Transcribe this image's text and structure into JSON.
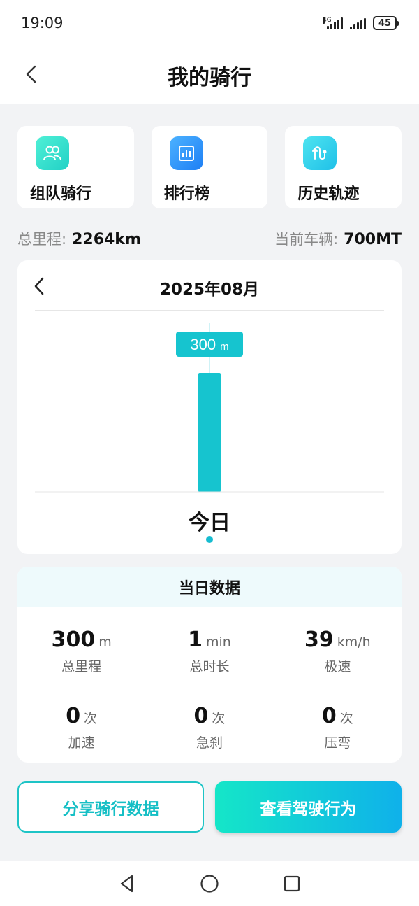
{
  "status_bar": {
    "time": "19:09",
    "network": "4G",
    "battery": "45"
  },
  "header": {
    "title": "我的骑行"
  },
  "quick_actions": [
    {
      "label": "组队骑行",
      "icon": "team-icon",
      "color": "#2ad4c7"
    },
    {
      "label": "排行榜",
      "icon": "ranking-icon",
      "color": "#2a8ff7"
    },
    {
      "label": "历史轨迹",
      "icon": "route-icon",
      "color": "#22c8ea"
    }
  ],
  "summary": {
    "total_distance_label": "总里程:",
    "total_distance_value": "2264km",
    "vehicle_label": "当前车辆:",
    "vehicle_value": "700MT"
  },
  "chart": {
    "month": "2025年08月",
    "tooltip_value": "300",
    "tooltip_unit": "m"
  },
  "chart_data": {
    "type": "bar",
    "categories": [
      "今日"
    ],
    "values": [
      300
    ],
    "unit": "m",
    "title": "2025年08月",
    "xlabel": "",
    "ylabel": "",
    "color": "#16c4cf"
  },
  "daily": {
    "title": "当日数据",
    "stats": [
      {
        "value": "300",
        "unit": "m",
        "label": "总里程"
      },
      {
        "value": "1",
        "unit": "min",
        "label": "总时长"
      },
      {
        "value": "39",
        "unit": "km/h",
        "label": "极速"
      },
      {
        "value": "0",
        "unit": "次",
        "label": "加速"
      },
      {
        "value": "0",
        "unit": "次",
        "label": "急刹"
      },
      {
        "value": "0",
        "unit": "次",
        "label": "压弯"
      }
    ]
  },
  "buttons": {
    "share": "分享骑行数据",
    "behavior": "查看驾驶行为"
  },
  "colors": {
    "accent": "#16c4cf",
    "background": "#f2f3f5"
  }
}
